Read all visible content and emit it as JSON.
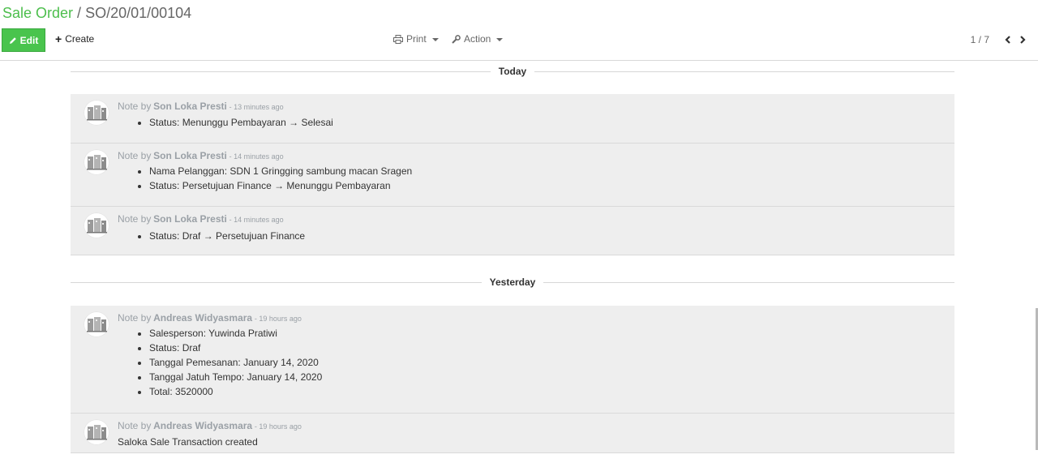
{
  "breadcrumb": {
    "parent": "Sale Order",
    "separator": "/",
    "current": "SO/20/01/00104"
  },
  "toolbar": {
    "edit_label": "Edit",
    "create_label": "Create",
    "print_label": "Print",
    "action_label": "Action"
  },
  "pager": {
    "value": "1 / 7"
  },
  "chatter": {
    "groups": [
      {
        "date_label": "Today",
        "messages": [
          {
            "note_prefix": "Note by",
            "author": "Son Loka Presti",
            "time": "- 13 minutes ago",
            "changes": [
              "Status: Menunggu Pembayaran → Selesai"
            ]
          },
          {
            "note_prefix": "Note by",
            "author": "Son Loka Presti",
            "time": "- 14 minutes ago",
            "changes": [
              "Nama Pelanggan: SDN 1 Gringging sambung macan Sragen",
              "Status: Persetujuan Finance → Menunggu Pembayaran"
            ]
          },
          {
            "note_prefix": "Note by",
            "author": "Son Loka Presti",
            "time": "- 14 minutes ago",
            "changes": [
              "Status: Draf → Persetujuan Finance"
            ]
          }
        ]
      },
      {
        "date_label": "Yesterday",
        "messages": [
          {
            "note_prefix": "Note by",
            "author": "Andreas Widyasmara",
            "time": "- 19 hours ago",
            "changes": [
              "Salesperson: Yuwinda Pratiwi",
              "Status: Draf",
              "Tanggal Pemesanan: January 14, 2020",
              "Tanggal Jatuh Tempo: January 14, 2020",
              "Total: 3520000"
            ]
          },
          {
            "note_prefix": "Note by",
            "author": "Andreas Widyasmara",
            "time": "- 19 hours ago",
            "body": "Saloka Sale Transaction created"
          }
        ]
      }
    ]
  }
}
